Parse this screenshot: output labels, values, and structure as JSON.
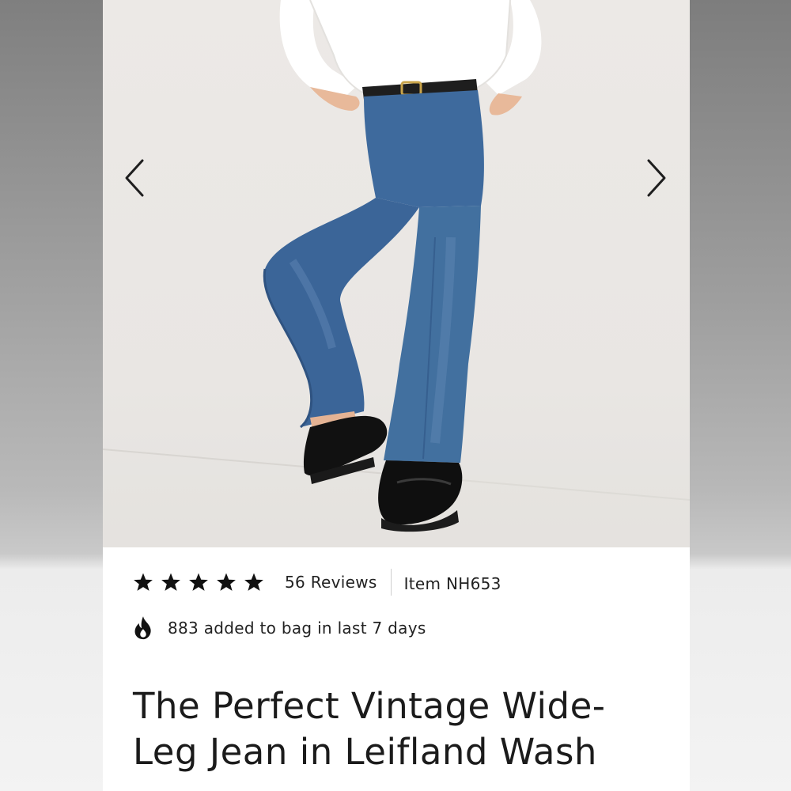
{
  "product": {
    "image_alt": "Model wearing wide-leg medium wash jeans with white shirt and black loafers",
    "nav": {
      "prev_icon": "chevron-left-icon",
      "next_icon": "chevron-right-icon"
    },
    "rating": {
      "stars": 5,
      "max_stars": 5,
      "reviews_label": "56 Reviews"
    },
    "item_number": "Item NH653",
    "popularity": {
      "icon": "flame-icon",
      "text": "883 added to bag in last 7 days"
    },
    "title": "The Perfect Vintage Wide-Leg Jean in Leifland Wash"
  },
  "colors": {
    "text": "#1b1b1b",
    "star": "#111111",
    "denim": "#3f6a9c",
    "background": "#ffffff"
  }
}
